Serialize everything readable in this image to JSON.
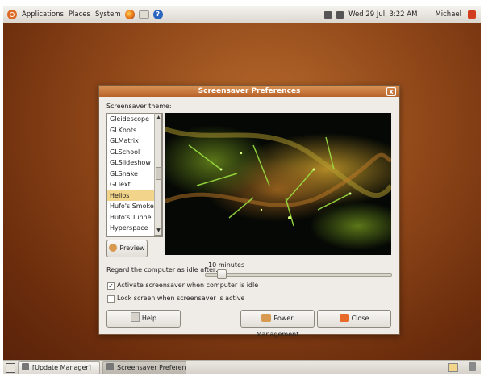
{
  "top_panel": {
    "applications": "Applications",
    "places": "Places",
    "system": "System",
    "clock": "Wed 29 Jul,  3:22 AM",
    "user": "Michael",
    "launchers": [
      "firefox-icon",
      "mail-icon",
      "help-icon"
    ],
    "help_glyph": "?"
  },
  "dialog": {
    "title": "Screensaver Preferences",
    "close_glyph": "x",
    "theme_label": "Screensaver theme:",
    "themes": [
      "Gleidescope",
      "GLKnots",
      "GLMatrix",
      "GLSchool",
      "GLSlideshow",
      "GLSnake",
      "GLText",
      "Helios",
      "Hufo's Smoke",
      "Hufo's Tunnel",
      "Hyperspace"
    ],
    "selected_theme": "Helios",
    "preview_button": "Preview",
    "idle_label": "Regard the computer as idle after:",
    "idle_value": "10 minutes",
    "activate_checkbox": {
      "label": "Activate screensaver when computer is idle",
      "checked": true
    },
    "lock_checkbox": {
      "label": "Lock screen when screensaver is active",
      "checked": false
    },
    "help_button": "Help",
    "power_button": "Power Management",
    "close_button": "Close"
  },
  "bottom_panel": {
    "tasks": [
      "[Update Manager]",
      "Screensaver Preferenc···"
    ]
  },
  "colors": {
    "accent": "#d9823b",
    "selection": "#f2d48a",
    "desktop": "#8e4618"
  }
}
